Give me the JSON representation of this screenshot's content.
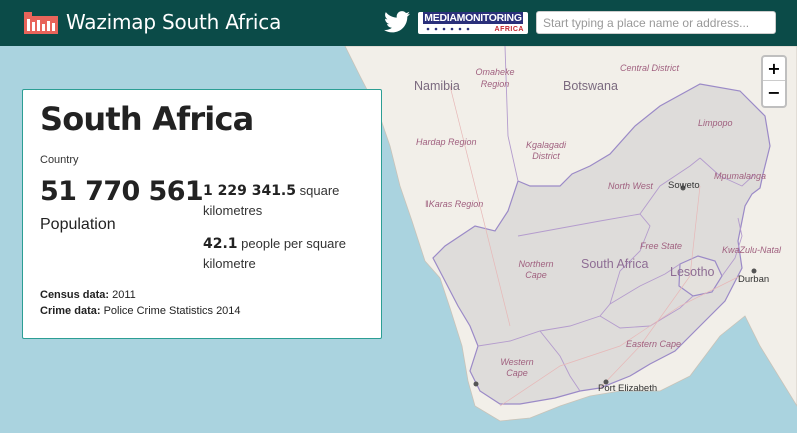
{
  "header": {
    "title": "Wazimap South Africa",
    "partner": {
      "top": "MEDIAMONITORING",
      "bottom": "AFRICA"
    },
    "search": {
      "placeholder": "Start typing a place name or address..."
    }
  },
  "colors": {
    "header_bg": "#0b4b48",
    "card_border": "#2c9e94",
    "sea": "#aad3df",
    "land": "#f2efe9",
    "highlight_land": "#dddddd",
    "border": "#9b8ac7"
  },
  "icons": {
    "logo": "wazimap-logo-icon",
    "twitter": "twitter-icon",
    "zoom_in": "zoom-in-icon",
    "zoom_out": "zoom-out-icon"
  },
  "map": {
    "zoom_in": "+",
    "zoom_out": "−",
    "labels": {
      "namibia": "Namibia",
      "botswana": "Botswana",
      "omaheke": "Omaheke\nRegion",
      "central_district": "Central District",
      "hardap": "Hardap Region",
      "kgalagadi": "Kgalagadi\nDistrict",
      "karas": "ǁKaras Region",
      "limpopo": "Limpopo",
      "north_west": "North West",
      "soweto": "Soweto",
      "mpumalanga": "Mpumalanga",
      "free_state": "Free State",
      "kwazulu": "KwaZulu-Natal",
      "northern_cape": "Northern\nCape",
      "south_africa": "South Africa",
      "lesotho": "Lesotho",
      "durban": "Durban",
      "eastern_cape": "Eastern Cape",
      "western_cape": "Western\nCape",
      "port_elizabeth": "Port Elizabeth"
    }
  },
  "profile": {
    "name": "South Africa",
    "type": "Country",
    "population": "51 770 561",
    "population_label": "Population",
    "area_value": "1 229 341.5",
    "area_unit": "square kilometres",
    "density_value": "42.1",
    "density_unit": "people per square kilometre",
    "census_label": "Census data:",
    "census_value": "2011",
    "crime_label": "Crime data:",
    "crime_value": "Police Crime Statistics 2014"
  }
}
